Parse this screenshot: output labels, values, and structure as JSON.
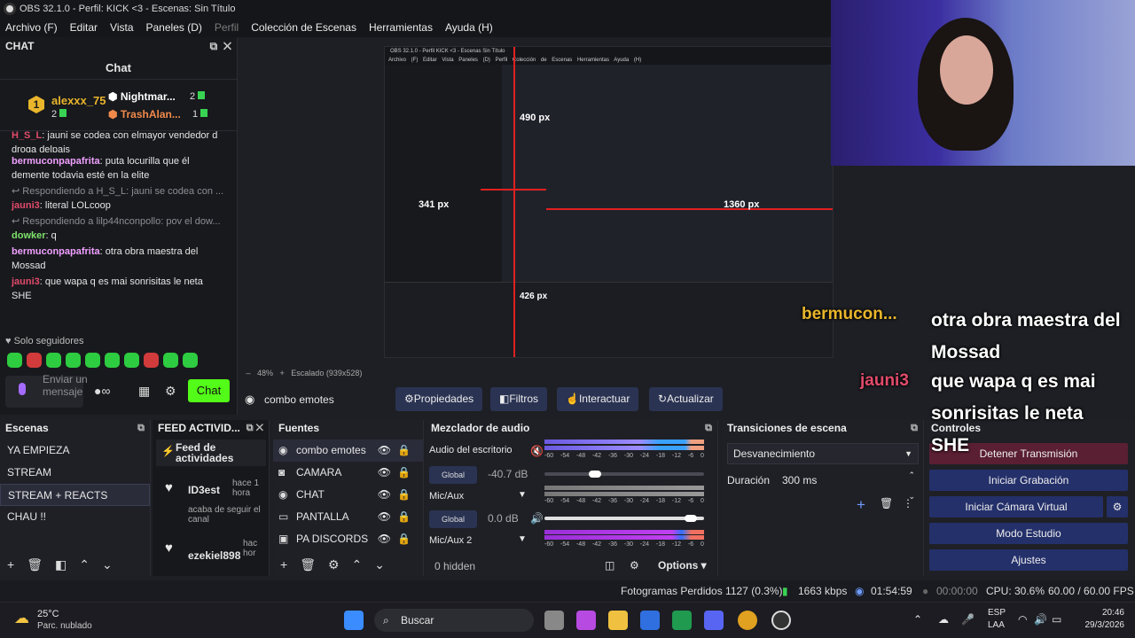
{
  "window": {
    "title": "OBS 32.1.0 - Perfil: KICK <3 - Escenas: Sin Título"
  },
  "menu": [
    "Archivo (F)",
    "Editar",
    "Vista",
    "Paneles (D)",
    "Perfil",
    "Colección de Escenas",
    "Herramientas",
    "Ayuda (H)"
  ],
  "chat": {
    "dock_title": "CHAT",
    "title": "Chat",
    "leaders": [
      {
        "name": "alexxx_75",
        "count": "2",
        "rank": "1"
      },
      {
        "name": "Nightmar...",
        "count": "2"
      },
      {
        "name": "TrashAlan...",
        "count": "1"
      }
    ],
    "messages": [
      {
        "user": "H_S_L",
        "text": "jauni se codea con elmayor vendedor d droga delpais",
        "cut": true
      },
      {
        "user": "bermuconpapafrita",
        "text": "puta locurilla que él demente todavia esté en la elite"
      },
      {
        "reply": "Respondiendo a H_S_L: jauni se codea con ..."
      },
      {
        "user": "jauni3",
        "text": "literal LOLcoop",
        "color": "#e24b6b"
      },
      {
        "reply": "Respondiendo a lilp44nconpollo: pov el dow..."
      },
      {
        "user": "dowker",
        "text": "q",
        "color": "#7ee36b"
      },
      {
        "user": "bermuconpapafrita",
        "text": "otra obra maestra del Mossad"
      },
      {
        "user": "jauni3",
        "text": "que wapa q es mai sonrisitas le neta SHE",
        "color": "#e24b6b"
      }
    ],
    "followers": "Solo seguidores",
    "input_placeholder": "Enviar un mensaje",
    "send": "Chat"
  },
  "preview": {
    "nested_title": "OBS 32.1.0 - Perfil KICK <3 - Escenas Sin Título",
    "nested_menu": "Archivo (F) Editar Vista Paneles (D) Perfil Colección de Escenas Herramientas Ayuda (H)",
    "measures": [
      "490 px",
      "341 px",
      "1360 px",
      "426 px"
    ],
    "zoom": "48%",
    "scaled": "Escalado (939x528)"
  },
  "source_toolbar": {
    "name": "combo emotes",
    "buttons": [
      "Propiedades",
      "Filtros",
      "Interactuar",
      "Actualizar"
    ]
  },
  "overlay": [
    {
      "user": "bermucon...",
      "text": "otra obra maestra del Mossad"
    },
    {
      "user": "jauni3",
      "text": "que wapa q es mai sonrisitas le neta SHE"
    }
  ],
  "scenes": {
    "title": "Escenas",
    "items": [
      "YA EMPIEZA",
      "STREAM",
      "STREAM + REACTS",
      "CHAU !!"
    ],
    "selected": 2
  },
  "feed": {
    "title": "FEED ACTIVID...",
    "header": "Feed de actividades",
    "items": [
      {
        "user": "ID3est",
        "time": "hace 1 hora",
        "text": "acaba de seguir el canal"
      },
      {
        "user": "ezekiel898",
        "time": "hac hor",
        "text": ""
      }
    ]
  },
  "sources": {
    "title": "Fuentes",
    "items": [
      "combo emotes",
      "CAMARA",
      "CHAT",
      "PANTALLA",
      "PA DISCORDS"
    ]
  },
  "mixer": {
    "title": "Mezclador de audio",
    "channels": [
      {
        "name": "Audio del escritorio",
        "db": "-40.7 dB",
        "level": 0.3
      },
      {
        "name": "Mic/Aux",
        "db": "0.0 dB",
        "level": 0.95
      },
      {
        "name": "Mic/Aux 2"
      }
    ],
    "scale": [
      "-60",
      "-54",
      "-48",
      "-42",
      "-36",
      "-30",
      "-24",
      "-18",
      "-12",
      "-6",
      "0"
    ],
    "global": "Global",
    "hidden": "0 hidden",
    "options": "Options"
  },
  "transitions": {
    "title": "Transiciones de escena",
    "selected": "Desvanecimiento",
    "duration_label": "Duración",
    "duration": "300 ms"
  },
  "controls": {
    "title": "Controles",
    "buttons": [
      "Detener Transmisión",
      "Iniciar Grabación",
      "Iniciar Cámara Virtual",
      "Modo Estudio",
      "Ajustes"
    ]
  },
  "status": {
    "dropped": "Fotogramas Perdidos 1127 (0.3%)",
    "kbps": "1663 kbps",
    "live": "01:54:59",
    "rec": "00:00:00",
    "cpu": "CPU: 30.6%",
    "fps": "60.00 / 60.00 FPS"
  },
  "taskbar": {
    "temp": "25°C",
    "weather": "Parc. nublado",
    "search": "Buscar",
    "lang": "ESP",
    "region": "LAA",
    "time": "20:46",
    "date": "29/3/2026"
  }
}
